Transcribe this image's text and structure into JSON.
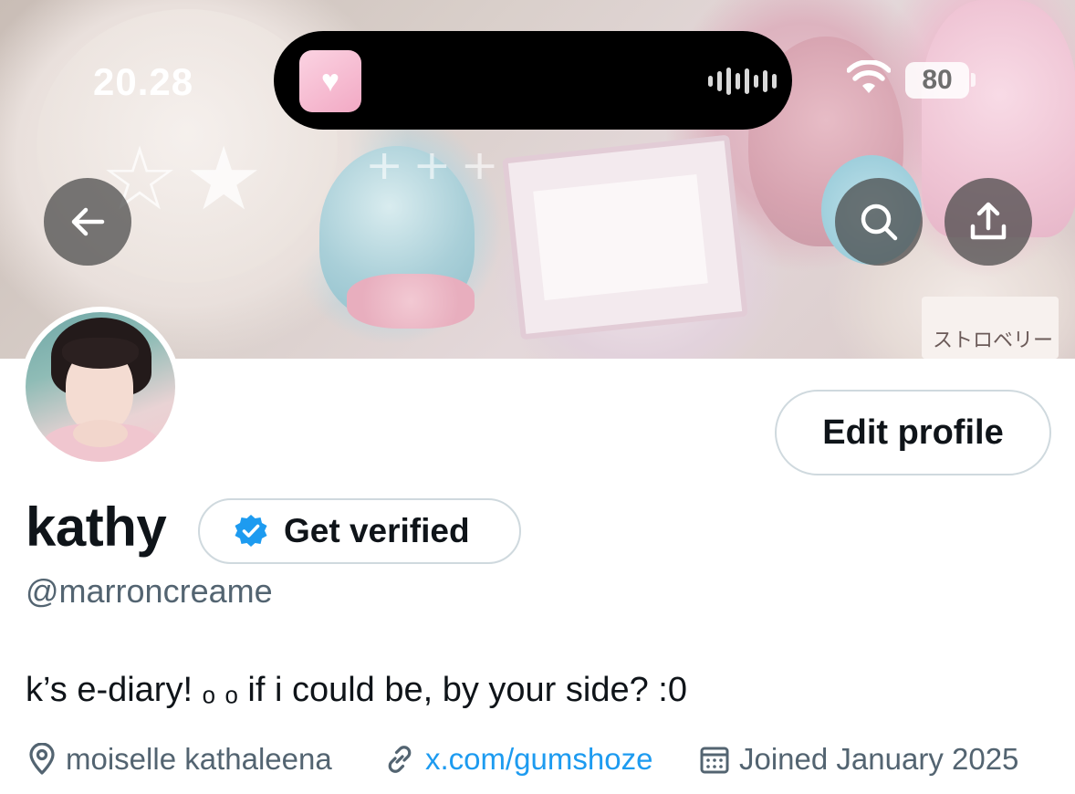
{
  "status_bar": {
    "time": "20.28",
    "battery": "80"
  },
  "header": {
    "banner_label": "ストロベリー"
  },
  "profile": {
    "display_name": "kathy",
    "handle": "@marroncreame",
    "bio": "k’s e-diary! ₒ ₒ if i could be, by your side? :0",
    "location": "moiselle kathaleena",
    "website": "x.com/gumshoze",
    "joined": "Joined January 2025"
  },
  "buttons": {
    "edit_profile": "Edit profile",
    "get_verified": "Get verified"
  },
  "colors": {
    "accent": "#1d9bf0",
    "text_primary": "#0f1419",
    "text_secondary": "#536471",
    "border": "#cfd9de"
  },
  "icons": {
    "back": "arrow-left-icon",
    "search": "search-icon",
    "share": "share-icon",
    "verified": "verified-badge-icon",
    "location": "location-pin-icon",
    "link": "link-icon",
    "calendar": "calendar-icon",
    "wifi": "wifi-icon",
    "voice_activity": "waveform-icon"
  }
}
